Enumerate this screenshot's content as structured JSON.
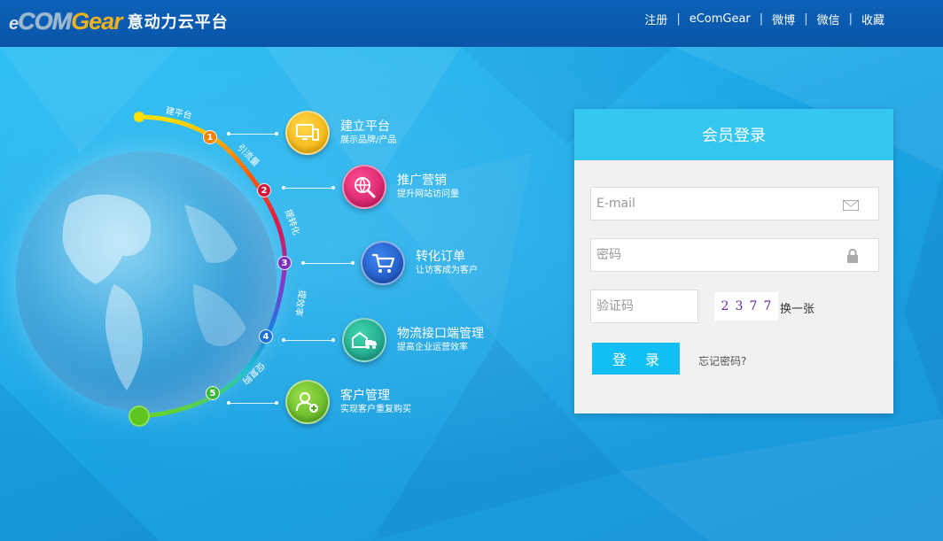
{
  "header": {
    "logo_e": "e",
    "logo_com": "COM",
    "logo_gear": "Gear",
    "logo_cn": "意动力云平台",
    "nav": [
      "注册",
      "eComGear",
      "微博",
      "微信",
      "收藏"
    ],
    "nav_separator": "|"
  },
  "arc": {
    "labels": [
      "建平台",
      "引流量",
      "提转化",
      "提效率",
      "促复购"
    ],
    "numbers": [
      "1",
      "2",
      "3",
      "4",
      "5"
    ]
  },
  "steps": [
    {
      "title": "建立平台",
      "subtitle": "展示品牌/产品",
      "icon": "monitor-devices-icon",
      "color": "#f5b800"
    },
    {
      "title": "推广营销",
      "subtitle": "提升网站访问量",
      "icon": "globe-search-icon",
      "color": "#e41a6f"
    },
    {
      "title": "转化订单",
      "subtitle": "让访客成为客户",
      "icon": "shopping-cart-icon",
      "color": "#1f57c6"
    },
    {
      "title": "物流接口端管理",
      "subtitle": "提高企业运营效率",
      "icon": "truck-warehouse-icon",
      "color": "#1aa98a"
    },
    {
      "title": "客户管理",
      "subtitle": "实现客户重复购买",
      "icon": "user-add-icon",
      "color": "#74c72a"
    }
  ],
  "login": {
    "title": "会员登录",
    "email_placeholder": "E-mail",
    "password_placeholder": "密码",
    "captcha_placeholder": "验证码",
    "captcha_chars": [
      "2",
      "3",
      "7",
      "7"
    ],
    "captcha_refresh": "换一张",
    "submit_label": "登 录",
    "forgot_label": "忘记密码?"
  }
}
